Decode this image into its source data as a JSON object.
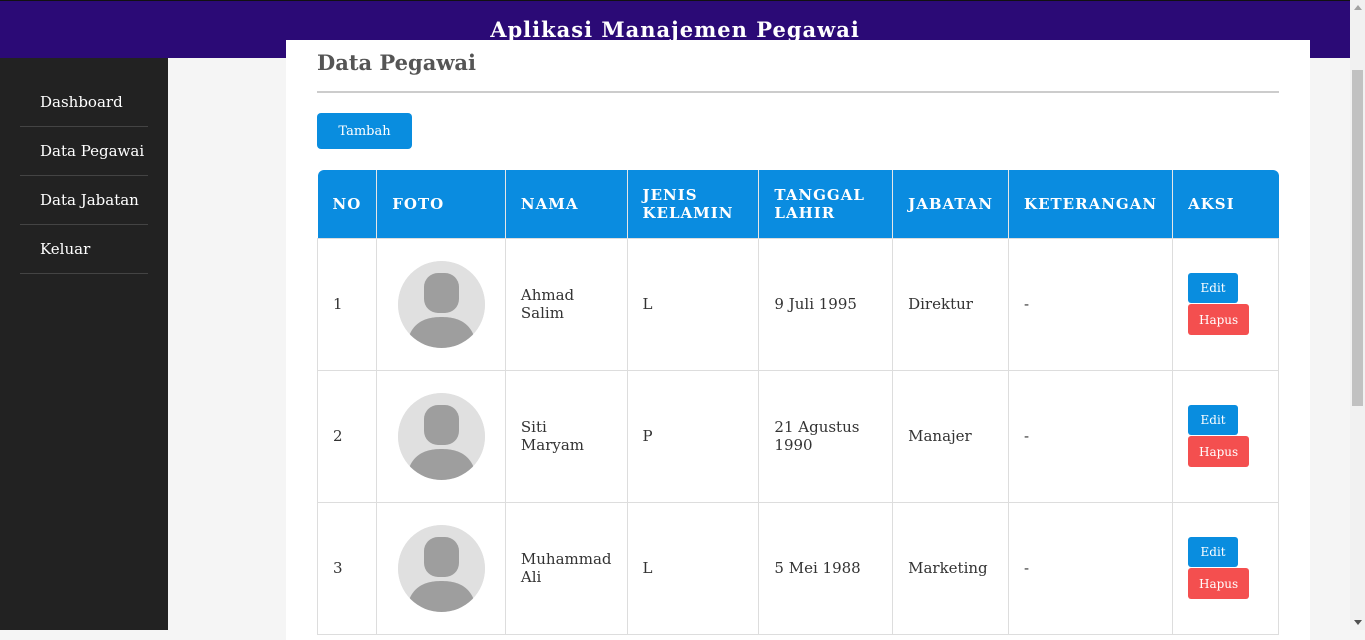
{
  "header": {
    "title": "Aplikasi Manajemen Pegawai"
  },
  "sidebar": {
    "items": [
      {
        "label": "Dashboard"
      },
      {
        "label": "Data Pegawai"
      },
      {
        "label": "Data Jabatan"
      },
      {
        "label": "Keluar"
      }
    ]
  },
  "main": {
    "title": "Data Pegawai",
    "add_label": "Tambah",
    "table": {
      "headers": [
        "NO",
        "FOTO",
        "NAMA",
        "JENIS KELAMIN",
        "TANGGAL LAHIR",
        "JABATAN",
        "KETERANGAN",
        "AKSI"
      ],
      "rows": [
        {
          "no": "1",
          "nama": "Ahmad Salim",
          "jk": "L",
          "tgl": "9 Juli 1995",
          "jabatan": "Direktur",
          "ket": "-"
        },
        {
          "no": "2",
          "nama": "Siti Maryam",
          "jk": "P",
          "tgl": "21 Agustus 1990",
          "jabatan": "Manajer",
          "ket": "-"
        },
        {
          "no": "3",
          "nama": "Muhammad Ali",
          "jk": "L",
          "tgl": "5 Mei 1988",
          "jabatan": "Marketing",
          "ket": "-"
        }
      ],
      "edit_label": "Edit",
      "delete_label": "Hapus"
    }
  },
  "colors": {
    "header_bg": "#2b0a76",
    "sidebar_bg": "#222222",
    "primary": "#098ddf",
    "danger": "#f44f4f"
  }
}
